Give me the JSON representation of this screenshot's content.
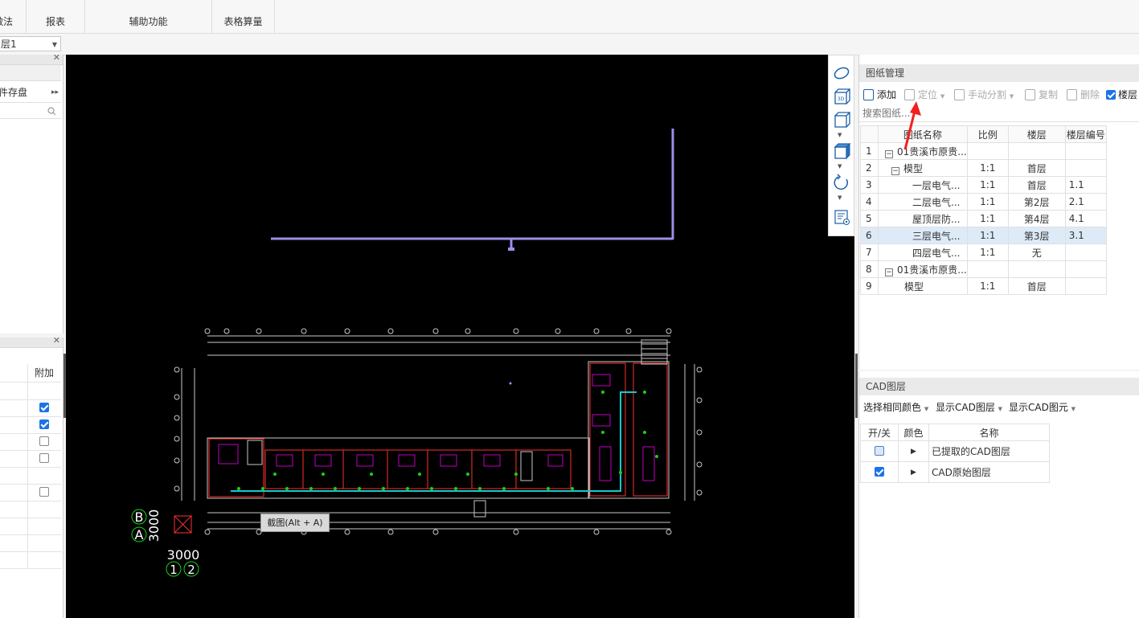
{
  "ribbon": {
    "groups": [
      {
        "label": "做法"
      },
      {
        "label": "报表"
      },
      {
        "label": "辅助功能"
      },
      {
        "label": "表格算量"
      }
    ]
  },
  "floor_selector": {
    "value": "层1"
  },
  "left_panel": {
    "tab_label": "件存盘",
    "column_header": "附加",
    "rows": [
      {
        "checked": false,
        "show_checkbox": false
      },
      {
        "checked": true,
        "show_checkbox": true
      },
      {
        "checked": true,
        "show_checkbox": true
      },
      {
        "checked": false,
        "show_checkbox": true
      },
      {
        "checked": false,
        "show_checkbox": true
      },
      {
        "checked": false,
        "show_checkbox": false
      },
      {
        "checked": false,
        "show_checkbox": true
      },
      {
        "checked": false,
        "show_checkbox": false
      },
      {
        "checked": false,
        "show_checkbox": false
      },
      {
        "checked": false,
        "show_checkbox": false
      },
      {
        "checked": false,
        "show_checkbox": false
      }
    ]
  },
  "canvas": {
    "tooltip": "截图(Alt + A)",
    "axis_labels": {
      "b": "B",
      "a": "A",
      "dim_vertical": "3000",
      "dim_horizontal": "3000",
      "col1": "1",
      "col2": "2"
    },
    "colors": {
      "background": "#000000",
      "pipe": "#9b8fe8",
      "grid": "#c8c8c8",
      "wall": "#ff3030",
      "fixture": "#c000c0",
      "device": "#19d119",
      "conduit": "#19c8c8"
    }
  },
  "drawing_panel": {
    "title": "图纸管理",
    "toolbar": {
      "add": "添加",
      "locate": "定位",
      "manual_split": "手动分割",
      "copy": "复制",
      "delete": "删除",
      "floor_checkbox_label": "楼层"
    },
    "search_placeholder": "搜索图纸...",
    "columns": [
      "图纸名称",
      "比例",
      "楼层",
      "楼层编号"
    ],
    "rows": [
      {
        "no": "1",
        "name": "01贵溪市原贵...",
        "level": 0,
        "toggle": "−",
        "scale": "",
        "floor": "",
        "floor_no": ""
      },
      {
        "no": "2",
        "name": "模型",
        "level": 1,
        "toggle": "−",
        "scale": "1:1",
        "floor": "首层",
        "floor_no": ""
      },
      {
        "no": "3",
        "name": "一层电气...",
        "level": 2,
        "toggle": "",
        "scale": "1:1",
        "floor": "首层",
        "floor_no": "1.1"
      },
      {
        "no": "4",
        "name": "二层电气...",
        "level": 2,
        "toggle": "",
        "scale": "1:1",
        "floor": "第2层",
        "floor_no": "2.1"
      },
      {
        "no": "5",
        "name": "屋顶层防...",
        "level": 2,
        "toggle": "",
        "scale": "1:1",
        "floor": "第4层",
        "floor_no": "4.1"
      },
      {
        "no": "6",
        "name": "三层电气...",
        "level": 2,
        "toggle": "",
        "scale": "1:1",
        "floor": "第3层",
        "floor_no": "3.1",
        "selected": true
      },
      {
        "no": "7",
        "name": "四层电气...",
        "level": 2,
        "toggle": "",
        "scale": "1:1",
        "floor": "无",
        "floor_no": ""
      },
      {
        "no": "8",
        "name": "01贵溪市原贵...",
        "level": 0,
        "toggle": "−",
        "scale": "",
        "floor": "",
        "floor_no": ""
      },
      {
        "no": "9",
        "name": "模型",
        "level": 1,
        "toggle": "",
        "scale": "1:1",
        "floor": "首层",
        "floor_no": ""
      }
    ]
  },
  "cad_panel": {
    "title": "CAD图层",
    "toolbar": {
      "select_same_color": "选择相同颜色",
      "show_cad_layer": "显示CAD图层",
      "show_cad_element": "显示CAD图元"
    },
    "columns": [
      "开/关",
      "颜色",
      "名称"
    ],
    "rows": [
      {
        "on": false,
        "name": "已提取的CAD图层"
      },
      {
        "on": true,
        "name": "CAD原始图层"
      }
    ]
  }
}
